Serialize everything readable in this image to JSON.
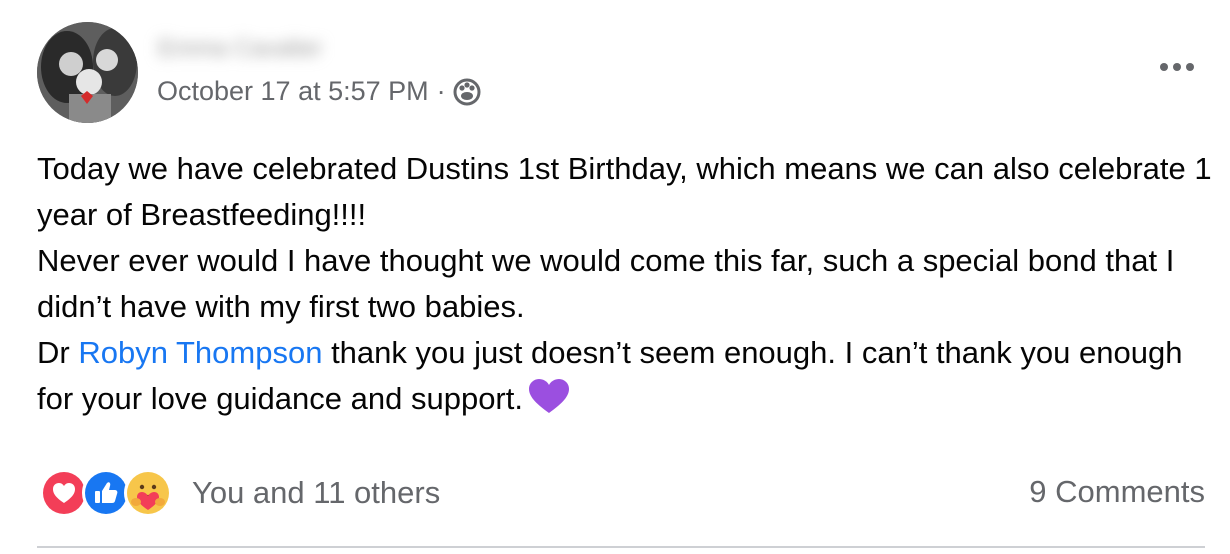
{
  "post": {
    "author_name": "Emma Cavalier",
    "timestamp": "October 17 at 5:57 PM",
    "separator": "·",
    "audience_icon": "friends-icon",
    "more_icon": "more-options-icon",
    "body": {
      "p1": "Today we have celebrated Dustins 1st Birthday, which means we can also celebrate 1 year of Breastfeeding!!!!",
      "p2": "Never ever would I have thought we would come this far, such a special bond that I didn’t have with my first two babies.",
      "p3_prefix": "Dr ",
      "p3_mention": "Robyn Thompson",
      "p3_suffix": " thank you just doesn’t seem enough. I can’t thank you enough for your love guidance and support.",
      "emoji": "purple-heart"
    }
  },
  "reactions": {
    "types": [
      "love",
      "like",
      "care"
    ],
    "summary": "You and 11 others",
    "comments": "9 Comments"
  },
  "colors": {
    "link": "#1877f2",
    "secondary_text": "#65676b",
    "love": "#f33e58",
    "like": "#1877f2",
    "purple_heart": "#9b4fe0"
  }
}
